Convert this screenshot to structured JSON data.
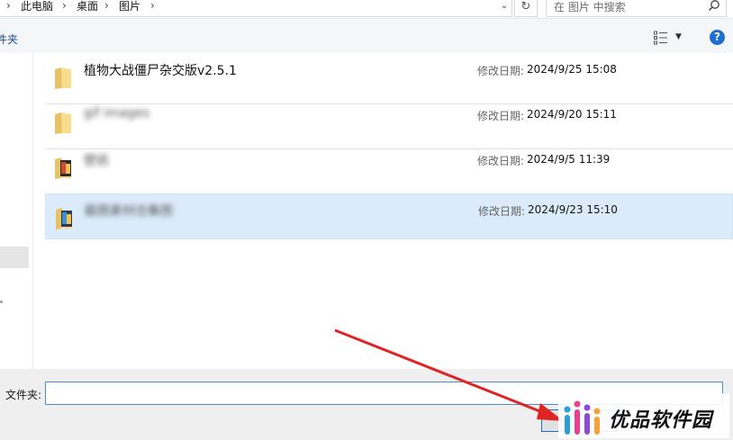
{
  "address_bar": {
    "breadcrumbs": [
      "此电脑",
      "桌面",
      "图片"
    ],
    "search_placeholder": "在 图片 中搜索"
  },
  "toolbar": {
    "new_folder_label": "件夹"
  },
  "files": [
    {
      "name": "植物大战僵尸杂交版v2.5.1",
      "date_label": "修改日期:",
      "date": "2024/9/25 15:08",
      "icon": "folder-icon",
      "blurred": false,
      "selected": false
    },
    {
      "name": "gif images",
      "date_label": "修改日期:",
      "date": "2024/9/20 15:11",
      "icon": "folder-icon",
      "blurred": true,
      "selected": false
    },
    {
      "name": "壁纸",
      "date_label": "修改日期:",
      "date": "2024/9/5 11:39",
      "icon": "image-folder-icon",
      "blurred": true,
      "selected": false
    },
    {
      "name": "截图素材合集图",
      "date_label": "修改日期:",
      "date": "2024/9/23 15:10",
      "icon": "image-folder-icon",
      "blurred": true,
      "selected": true
    }
  ],
  "footer": {
    "folder_label": "文件夹:",
    "folder_value": ""
  },
  "watermark": {
    "text": "优品软件园"
  },
  "colors": {
    "accent": "#1e6fd2",
    "selection": "#dcebfb",
    "arrow": "#e02424"
  }
}
